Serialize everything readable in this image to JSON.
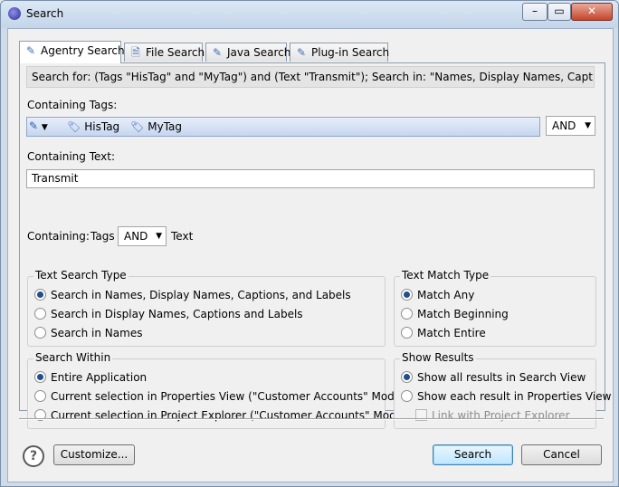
{
  "window": {
    "title": "Search",
    "minimize": "–",
    "maximize": "▭",
    "close": "✕"
  },
  "tabs": [
    {
      "label": "Agentry Search",
      "icon": "wand-icon",
      "active": true
    },
    {
      "label": "File Search",
      "icon": "file-search-icon",
      "active": false
    },
    {
      "label": "Java Search",
      "icon": "java-search-icon",
      "active": false
    },
    {
      "label": "Plug-in Search",
      "icon": "plugin-search-icon",
      "active": false
    }
  ],
  "summary": "Search for: (Tags \"HisTag\" and \"MyTag\") and (Text \"Transmit\");  Search in: \"Names, Display Names, Captions, and Lab",
  "containing_tags": {
    "label": "Containing Tags:",
    "tags": [
      "HisTag",
      "MyTag"
    ],
    "operator": "AND"
  },
  "containing_text": {
    "label": "Containing Text:",
    "value": "Transmit"
  },
  "containing": {
    "label": "Containing:",
    "left": "Tags",
    "operator": "AND",
    "right": "Text"
  },
  "text_search_type": {
    "title": "Text Search Type",
    "options": [
      {
        "label": "Search in Names, Display Names, Captions, and Labels",
        "selected": true
      },
      {
        "label": "Search in Display Names, Captions and Labels",
        "selected": false
      },
      {
        "label": "Search in Names",
        "selected": false
      }
    ]
  },
  "text_match_type": {
    "title": "Text Match Type",
    "options": [
      {
        "label": "Match Any",
        "selected": true
      },
      {
        "label": "Match Beginning",
        "selected": false
      },
      {
        "label": "Match Entire",
        "selected": false
      }
    ]
  },
  "search_within": {
    "title": "Search Within",
    "options": [
      {
        "label": "Entire Application",
        "selected": true
      },
      {
        "label": "Current selection in Properties View (\"Customer Accounts\" Module)",
        "selected": false
      },
      {
        "label": "Current selection in Project Explorer (\"Customer Accounts\" Module)",
        "selected": false
      }
    ]
  },
  "show_results": {
    "title": "Show Results",
    "options": [
      {
        "label": "Show all results in Search View",
        "selected": true
      },
      {
        "label": "Show each result in Properties View",
        "selected": false
      }
    ],
    "link_checkbox": {
      "label": "Link with Project Explorer",
      "checked": false,
      "enabled": false
    }
  },
  "footer": {
    "help": "?",
    "customize": "Customize...",
    "search": "Search",
    "cancel": "Cancel"
  }
}
